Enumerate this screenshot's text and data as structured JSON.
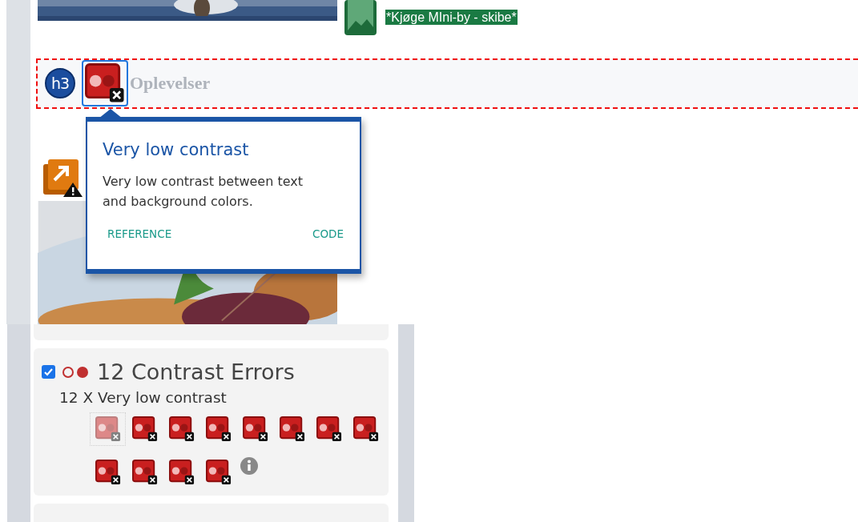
{
  "page": {
    "image_alt": "*Kjøge MIni-by - skibe*",
    "heading": {
      "level_badge": "h3",
      "text": "Oplevelser"
    }
  },
  "tooltip": {
    "title": "Very low contrast",
    "body": "Very low contrast between text and background colors.",
    "links": [
      "REFERENCE",
      "CODE"
    ]
  },
  "panel": {
    "group": {
      "checked": true,
      "title": "12 Contrast Errors",
      "subtitle": "12 X Very low contrast",
      "errors": [
        {
          "selected": true
        },
        {
          "selected": false
        },
        {
          "selected": false
        },
        {
          "selected": false
        },
        {
          "selected": false
        },
        {
          "selected": false
        },
        {
          "selected": false
        },
        {
          "selected": false
        },
        {
          "selected": false
        },
        {
          "selected": false
        },
        {
          "selected": false
        },
        {
          "selected": false
        }
      ]
    }
  }
}
